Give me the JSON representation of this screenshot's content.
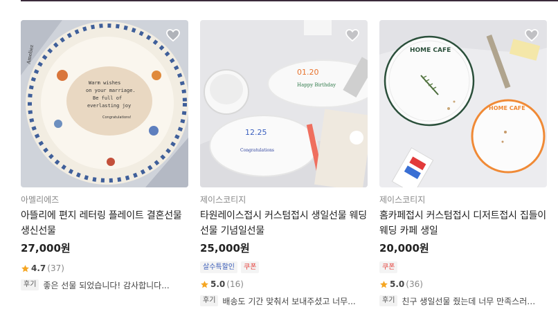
{
  "products": [
    {
      "shop": "아멜리에즈",
      "title": "아뜰리에 편지 레터링 플레이트 결혼선물 생신선물",
      "price": "27,000원",
      "badges": [],
      "rating": "4.7",
      "review_count": "(37)",
      "review_tag": "후기",
      "review_text": "좋은 선물 되었습니다! 감사합니다...",
      "image": {
        "plate_text": [
          "Warm wishes",
          "on your marriage.",
          "Be full of",
          "everlasting joy",
          "Congratulations!"
        ],
        "side_text": "Ameliez"
      }
    },
    {
      "shop": "제이스코티지",
      "title": "타원레이스접시 커스텀접시 생일선물 웨딩선물 기념일선물",
      "price": "25,000원",
      "badges": [
        {
          "label": "살수특할인",
          "color": "blue"
        },
        {
          "label": "쿠폰",
          "color": "red"
        }
      ],
      "rating": "5.0",
      "review_count": "(16)",
      "review_tag": "후기",
      "review_text": "배송도 기간 맞춰서 보내주셨고 너무...",
      "image": {
        "plate1_date": "01.20",
        "plate1_text": "Happy Birthday",
        "plate2_date": "12.25",
        "plate2_text": "Congratulations"
      }
    },
    {
      "shop": "제이스코티지",
      "title": "홈카페접시 커스텀접시 디저트접시 집들이 웨딩 카페 생일",
      "price": "20,000원",
      "badges": [
        {
          "label": "쿠폰",
          "color": "red"
        }
      ],
      "rating": "5.0",
      "review_count": "(36)",
      "review_tag": "후기",
      "review_text": "친구 생일선물 줬는데 너무 만족스러워요",
      "image": {
        "plate1_text": "HOME CAFE",
        "plate2_text": "HOME CAFE"
      }
    }
  ],
  "colors": {
    "star": "#f5a623",
    "badge_blue": "#3b5db8",
    "badge_red": "#e5413b"
  },
  "icons": {
    "heart": "heart-outline-icon",
    "star": "star-icon"
  }
}
